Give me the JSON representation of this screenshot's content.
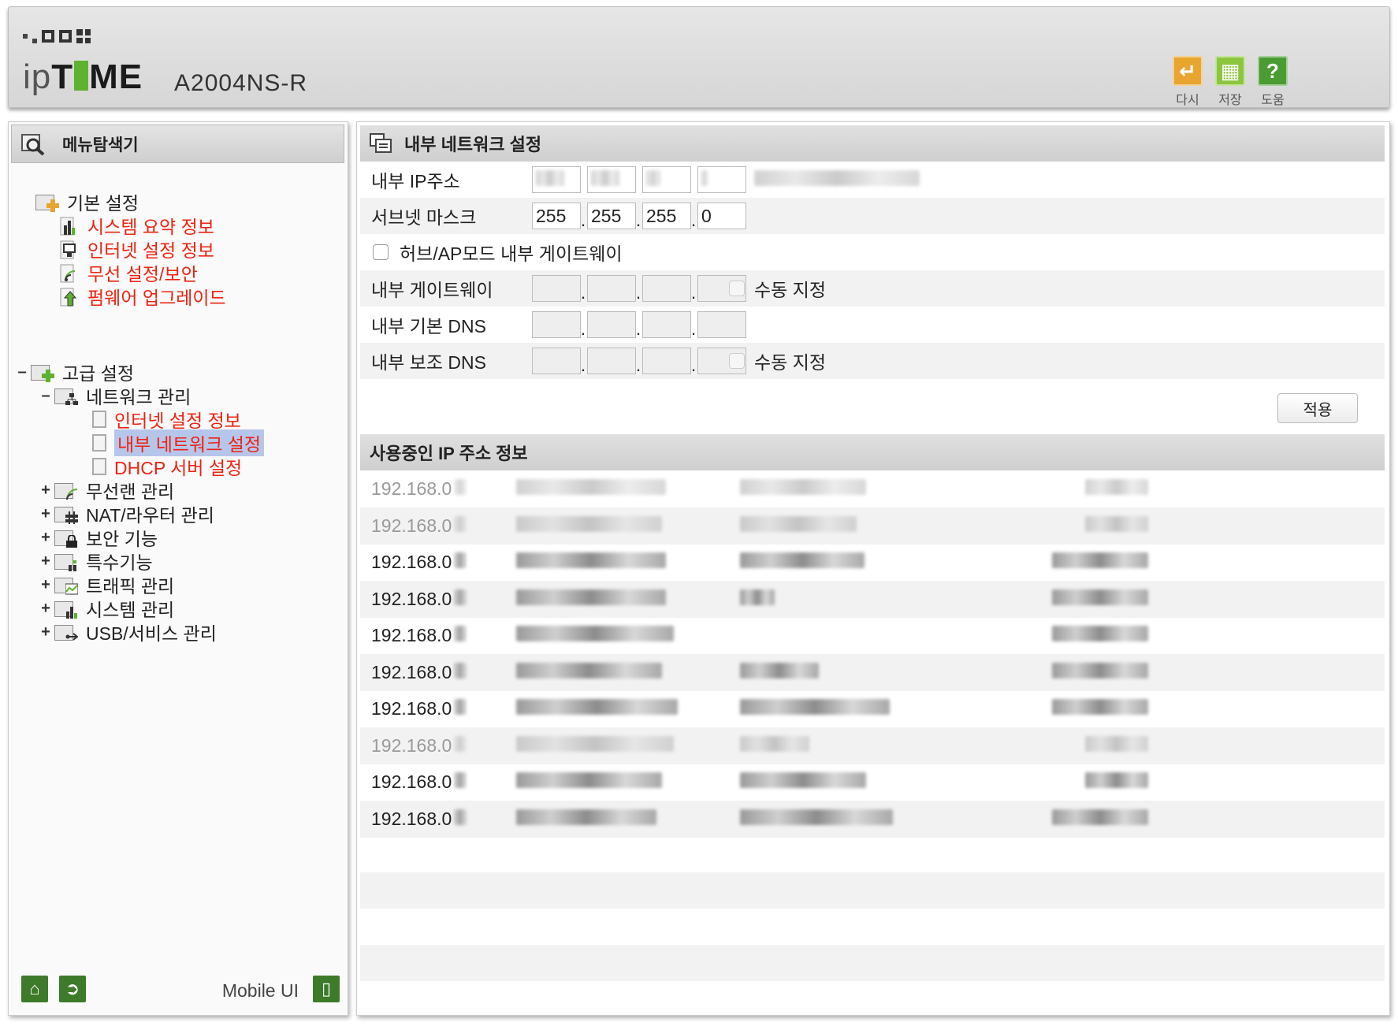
{
  "header": {
    "brand": "ipTIME",
    "model": "A2004NS-R",
    "buttons": [
      {
        "label": "다시",
        "icon": "undo-icon",
        "color": "#e8a530"
      },
      {
        "label": "저장",
        "icon": "save-icon",
        "color": "#8cc63e"
      },
      {
        "label": "도움",
        "icon": "help-icon",
        "color": "#4a9b32"
      }
    ]
  },
  "sidebar": {
    "title": "메뉴탐색기",
    "basic": {
      "label": "기본 설정",
      "items": [
        "시스템 요약 정보",
        "인터넷 설정 정보",
        "무선 설정/보안",
        "펌웨어 업그레이드"
      ]
    },
    "advanced": {
      "label": "고급 설정",
      "network": {
        "label": "네트워크 관리",
        "items": [
          "인터넷 설정 정보",
          "내부 네트워크 설정",
          "DHCP 서버 설정"
        ]
      },
      "groups": [
        "무선랜 관리",
        "NAT/라우터 관리",
        "보안 기능",
        "특수기능",
        "트래픽 관리",
        "시스템 관리",
        "USB/서비스 관리"
      ]
    },
    "footer": {
      "mobile_label": "Mobile UI"
    }
  },
  "main": {
    "title": "내부 네트워크 설정",
    "fields": {
      "ip_label": "내부 IP주소",
      "mask_label": "서브넷 마스크",
      "mask": [
        "255",
        "255",
        "255",
        "0"
      ],
      "hub_label": "허브/AP모드 내부 게이트웨이",
      "gateway_label": "내부 게이트웨이",
      "dns1_label": "내부 기본 DNS",
      "dns2_label": "내부 보조 DNS",
      "manual_label": "수동 지정"
    },
    "apply_label": "적용",
    "ip_info": {
      "title": "사용중인 IP 주소 정보",
      "rows": [
        {
          "ip": "192.168.0",
          "active": false
        },
        {
          "ip": "192.168.0",
          "active": false
        },
        {
          "ip": "192.168.0",
          "active": true
        },
        {
          "ip": "192.168.0",
          "active": true
        },
        {
          "ip": "192.168.0",
          "active": true
        },
        {
          "ip": "192.168.0",
          "active": true
        },
        {
          "ip": "192.168.0",
          "active": true
        },
        {
          "ip": "192.168.0",
          "active": false
        },
        {
          "ip": "192.168.0",
          "active": true
        },
        {
          "ip": "192.168.0",
          "active": true
        }
      ]
    }
  }
}
